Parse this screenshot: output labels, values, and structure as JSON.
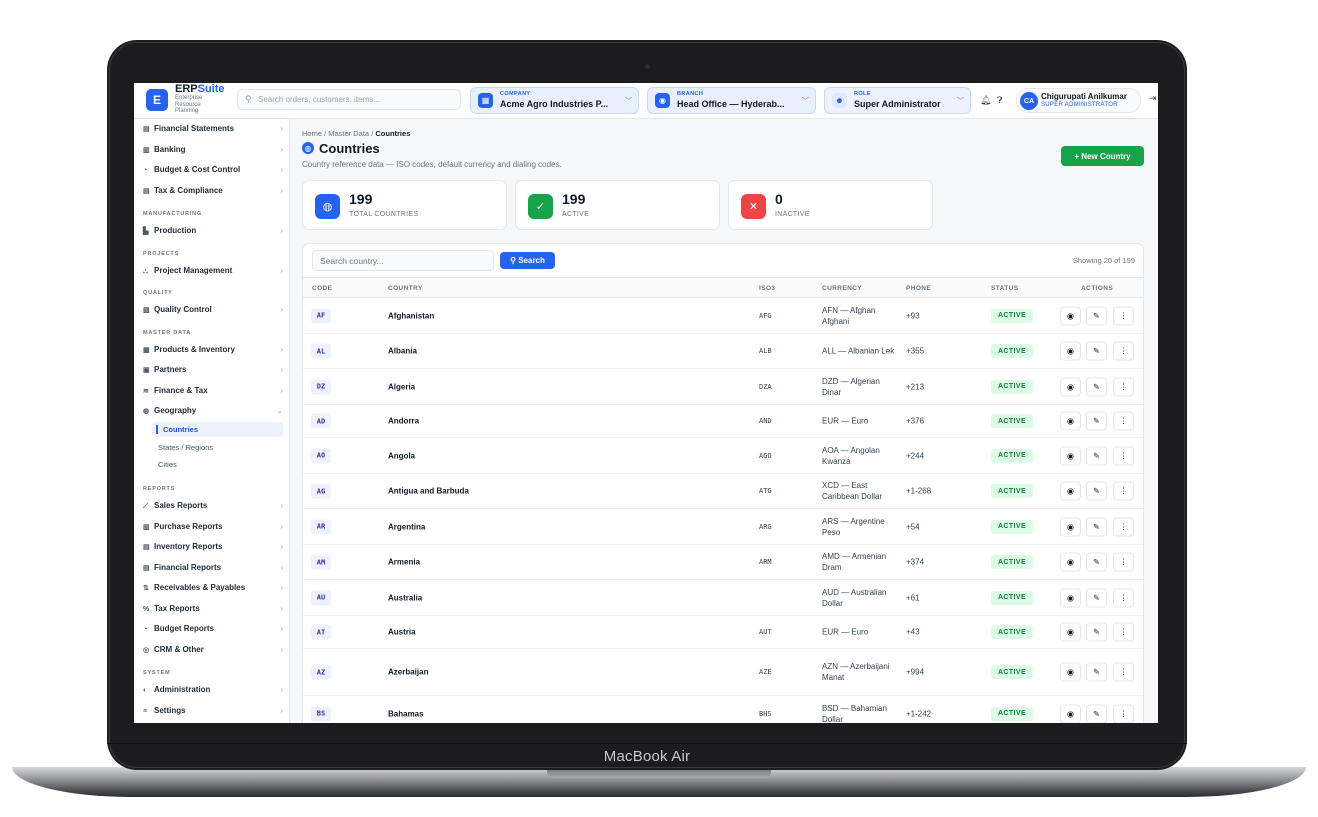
{
  "device": {
    "label": "MacBook Air"
  },
  "topbar": {
    "logo_letter": "E",
    "brand_main": "ERP",
    "brand_accent": "Suite",
    "brand_sub": "Enterprise Resource Planning",
    "search_placeholder": "Search orders, customers, items...",
    "company": {
      "label": "COMPANY",
      "value": "Acme Agro Industries P..."
    },
    "branch": {
      "label": "BRANCH",
      "value": "Head Office — Hyderab..."
    },
    "role": {
      "label": "ROLE",
      "value": "Super Administrator"
    },
    "user": {
      "initials": "CA",
      "name": "Chigurupati Anilkumar",
      "role": "SUPER ADMINISTRATOR"
    }
  },
  "sidebar": {
    "top_items": [
      {
        "icon": "▤",
        "label": "Financial Statements"
      },
      {
        "icon": "▥",
        "label": "Banking"
      },
      {
        "icon": "◔",
        "label": "Budget & Cost Control"
      },
      {
        "icon": "▤",
        "label": "Tax & Compliance"
      }
    ],
    "sections": {
      "manufacturing": "MANUFACTURING",
      "projects": "PROJECTS",
      "quality": "QUALITY",
      "master_data": "MASTER DATA",
      "reports": "REPORTS",
      "system": "SYSTEM"
    },
    "production": "Production",
    "project_management": "Project Management",
    "quality_control": "Quality Control",
    "master_items": [
      {
        "icon": "▦",
        "label": "Products & Inventory"
      },
      {
        "icon": "▣",
        "label": "Partners"
      },
      {
        "icon": "≋",
        "label": "Finance & Tax"
      },
      {
        "icon": "◍",
        "label": "Geography"
      }
    ],
    "geography_children": [
      "Countries",
      "States / Regions",
      "Cities"
    ],
    "report_items": [
      {
        "icon": "⟋",
        "label": "Sales Reports"
      },
      {
        "icon": "▥",
        "label": "Purchase Reports"
      },
      {
        "icon": "▤",
        "label": "Inventory Reports"
      },
      {
        "icon": "▤",
        "label": "Financial Reports"
      },
      {
        "icon": "⇅",
        "label": "Receivables & Payables"
      },
      {
        "icon": "%",
        "label": "Tax Reports"
      },
      {
        "icon": "◔",
        "label": "Budget Reports"
      },
      {
        "icon": "◎",
        "label": "CRM & Other"
      }
    ],
    "system_items": [
      {
        "icon": "◐",
        "label": "Administration"
      },
      {
        "icon": "≡",
        "label": "Settings"
      }
    ]
  },
  "page": {
    "breadcrumb_prefix": "Home / Master Data / ",
    "breadcrumb_current": "Countries",
    "title": "Countries",
    "subtitle": "Country reference data — ISO codes, default currency and dialing codes.",
    "new_button": "+ New Country"
  },
  "stats": [
    {
      "value": "199",
      "label": "TOTAL COUNTRIES",
      "color": "#2563eb",
      "icon": "◍"
    },
    {
      "value": "199",
      "label": "ACTIVE",
      "color": "#16a34a",
      "icon": "✓"
    },
    {
      "value": "0",
      "label": "INACTIVE",
      "color": "#ef4444",
      "icon": "✕"
    }
  ],
  "table": {
    "search_placeholder": "Search country...",
    "search_button": "Search",
    "showing": "Showing 20 of 199",
    "headers": {
      "code": "CODE",
      "country": "COUNTRY",
      "iso3": "ISO3",
      "currency": "CURRENCY",
      "phone": "PHONE",
      "status": "STATUS",
      "actions": "ACTIONS"
    },
    "rows": [
      {
        "code": "AF",
        "country": "Afghanistan",
        "iso3": "AFG",
        "currency": "AFN — Afghan Afghani",
        "phone": "+93",
        "status": "ACTIVE"
      },
      {
        "code": "AL",
        "country": "Albania",
        "iso3": "ALB",
        "currency": "ALL — Albanian Lek",
        "phone": "+355",
        "status": "ACTIVE"
      },
      {
        "code": "DZ",
        "country": "Algeria",
        "iso3": "DZA",
        "currency": "DZD — Algerian Dinar",
        "phone": "+213",
        "status": "ACTIVE"
      },
      {
        "code": "AD",
        "country": "Andorra",
        "iso3": "AND",
        "currency": "EUR — Euro",
        "phone": "+376",
        "status": "ACTIVE"
      },
      {
        "code": "AO",
        "country": "Angola",
        "iso3": "AGO",
        "currency": "AOA — Angolan Kwanza",
        "phone": "+244",
        "status": "ACTIVE"
      },
      {
        "code": "AG",
        "country": "Antigua and Barbuda",
        "iso3": "ATG",
        "currency": "XCD — East Caribbean Dollar",
        "phone": "+1-268",
        "status": "ACTIVE"
      },
      {
        "code": "AR",
        "country": "Argentina",
        "iso3": "ARG",
        "currency": "ARS — Argentine Peso",
        "phone": "+54",
        "status": "ACTIVE"
      },
      {
        "code": "AM",
        "country": "Armenia",
        "iso3": "ARM",
        "currency": "AMD — Armenian Dram",
        "phone": "+374",
        "status": "ACTIVE"
      },
      {
        "code": "AU",
        "country": "Australia",
        "iso3": "",
        "currency": "AUD — Australian Dollar",
        "phone": "+61",
        "status": "ACTIVE"
      },
      {
        "code": "AT",
        "country": "Austria",
        "iso3": "AUT",
        "currency": "EUR — Euro",
        "phone": "+43",
        "status": "ACTIVE"
      },
      {
        "code": "AZ",
        "country": "Azerbaijan",
        "iso3": "AZE",
        "currency": "AZN — Azerbaijani Manat",
        "phone": "+994",
        "status": "ACTIVE"
      },
      {
        "code": "BS",
        "country": "Bahamas",
        "iso3": "BHS",
        "currency": "BSD — Bahamian Dollar",
        "phone": "+1-242",
        "status": "ACTIVE"
      }
    ]
  }
}
